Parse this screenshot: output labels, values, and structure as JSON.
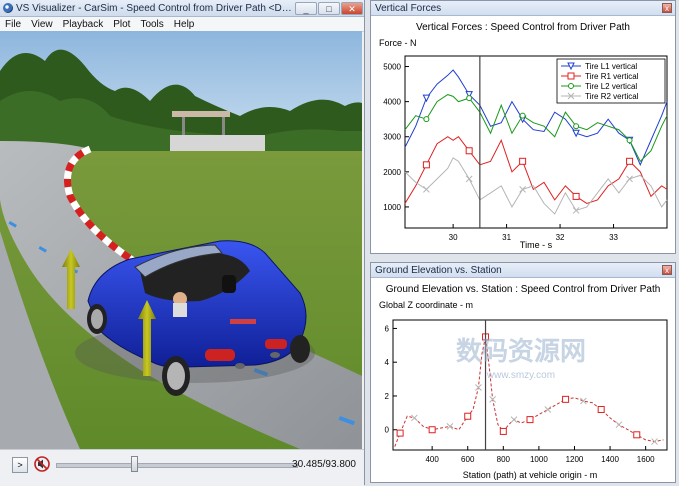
{
  "app": {
    "title": "VS Visualizer - CarSim - Speed Control from Driver Path <Driver Speed...",
    "menu": [
      "File",
      "View",
      "Playback",
      "Plot",
      "Tools",
      "Help"
    ],
    "window_buttons": [
      "_",
      "□",
      "✕"
    ]
  },
  "playback": {
    "play_label": ">",
    "time_readout": "30.485/93.800",
    "position_fraction": 0.3249,
    "icons": {
      "play": "play-icon",
      "mute": "speaker-muted-icon"
    }
  },
  "colors": {
    "series_l1": "#1f3fd0",
    "series_r1": "#e02020",
    "series_l2": "#1a9a1a",
    "series_r2": "#b5b5b5",
    "elevation": "#cc3333",
    "car": "#1630c8",
    "force_arrow": "#9a9a10"
  },
  "panels": [
    {
      "window_title": "Vertical Forces",
      "close_label": "x",
      "chart_data": {
        "type": "line",
        "title": "Vertical Forces : Speed Control from Driver Path",
        "ylabel": "Force - N",
        "xlabel": "Time - s",
        "xlim": [
          29.1,
          34.0
        ],
        "ylim": [
          400,
          5300
        ],
        "xticks": [
          30,
          31,
          32,
          33
        ],
        "yticks": [
          1000,
          2000,
          3000,
          4000,
          5000
        ],
        "cursor_x": 30.5,
        "legend_position": "top-right",
        "x": [
          29.1,
          29.3,
          29.5,
          29.7,
          29.9,
          30.0,
          30.1,
          30.3,
          30.5,
          30.7,
          30.9,
          31.1,
          31.3,
          31.5,
          31.7,
          31.9,
          32.1,
          32.3,
          32.5,
          32.7,
          32.9,
          33.1,
          33.3,
          33.5,
          33.7,
          33.9,
          34.0
        ],
        "series": [
          {
            "name": "Tire L1 vertical",
            "marker": "triangle-down",
            "values": [
              2700,
              3300,
              4100,
              4500,
              4750,
              4900,
              4700,
              4200,
              3900,
              3300,
              3400,
              4000,
              3500,
              3200,
              3150,
              3700,
              3500,
              3100,
              3000,
              3100,
              3500,
              3100,
              2900,
              2200,
              2900,
              3600,
              4000
            ]
          },
          {
            "name": "Tire R1 vertical",
            "marker": "square",
            "values": [
              1100,
              1600,
              2200,
              2800,
              3000,
              2900,
              3000,
              2600,
              2200,
              2300,
              2900,
              2000,
              2300,
              1500,
              1700,
              1200,
              1600,
              1300,
              1100,
              1200,
              1600,
              1800,
              2300,
              2000,
              1300,
              1600,
              1500
            ]
          },
          {
            "name": "Tire L2 vertical",
            "marker": "circle",
            "values": [
              3200,
              3600,
              3500,
              4000,
              4200,
              4150,
              4000,
              4100,
              3700,
              3100,
              3900,
              3100,
              3600,
              3400,
              3300,
              3000,
              3700,
              3300,
              3200,
              3400,
              3300,
              3200,
              2900,
              2300,
              2600,
              3300,
              3600
            ]
          },
          {
            "name": "Tire R2 vertical",
            "marker": "x",
            "values": [
              2000,
              1700,
              1500,
              1800,
              2100,
              2400,
              2300,
              1800,
              1200,
              1400,
              1600,
              1000,
              1500,
              1600,
              1100,
              800,
              1400,
              900,
              1000,
              1400,
              1800,
              1400,
              1800,
              1900,
              1600,
              1000,
              1200
            ]
          }
        ]
      }
    },
    {
      "window_title": "Ground Elevation vs. Station",
      "close_label": "x",
      "chart_data": {
        "type": "line",
        "title": "Ground Elevation vs. Station : Speed Control from Driver Path",
        "ylabel": "Global Z coordinate - m",
        "xlabel": "Station (path) at vehicle origin - m",
        "xlim": [
          180,
          1720
        ],
        "ylim": [
          -1.2,
          6.5
        ],
        "xticks": [
          400,
          600,
          800,
          1000,
          1200,
          1400,
          1600
        ],
        "yticks": [
          0,
          2,
          4,
          6
        ],
        "cursor_x": 700,
        "x": [
          190,
          220,
          260,
          300,
          350,
          400,
          450,
          500,
          550,
          600,
          630,
          660,
          680,
          700,
          720,
          740,
          770,
          800,
          830,
          860,
          900,
          950,
          1000,
          1050,
          1100,
          1150,
          1200,
          1250,
          1300,
          1350,
          1400,
          1450,
          1500,
          1550,
          1600,
          1650,
          1700
        ],
        "series": [
          {
            "name": "",
            "values": [
              -1.0,
              -0.2,
              0.8,
              0.7,
              0.2,
              0.0,
              0.1,
              0.2,
              0.0,
              0.8,
              1.2,
              2.5,
              4.5,
              5.5,
              3.8,
              1.8,
              0.3,
              -0.1,
              0.3,
              0.6,
              0.4,
              0.6,
              0.9,
              1.2,
              1.5,
              1.8,
              1.9,
              1.7,
              1.6,
              1.2,
              0.7,
              0.3,
              0.0,
              -0.3,
              -0.6,
              -0.7,
              -0.6
            ]
          }
        ]
      }
    }
  ],
  "watermark": {
    "text_main": "数码资源网",
    "text_url": "www.smzy.com"
  }
}
